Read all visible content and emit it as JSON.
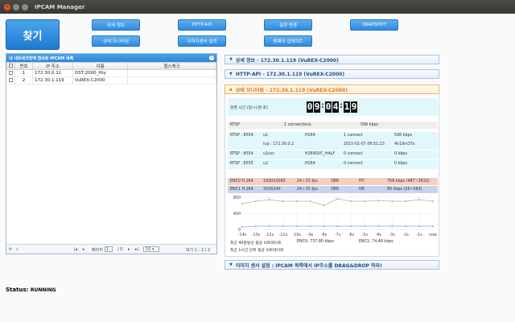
{
  "window": {
    "title": "IPCAM Manager"
  },
  "search_button": "찾기",
  "nav": {
    "detail_info": "상세 정보",
    "http_api": "HTTP-API",
    "config_change": "설정 변경",
    "snapshot": "SNAPSHOT",
    "status_monitor": "상태 모니터링",
    "image_sensor": "이미지센서 설정",
    "firmware": "펌웨어 업데이트"
  },
  "camera_list": {
    "header": "내 네트워크망에 접속된 IPCAM 목록",
    "columns": [
      "번호",
      "IP 주소",
      "이름",
      "헬스체크"
    ],
    "rows": [
      {
        "no": "1",
        "ip": "172.30.0.11",
        "name": "DST-2000_Hty",
        "health": ""
      },
      {
        "no": "2",
        "ip": "172.30.1.119",
        "name": "VuREX-C2000",
        "health": ""
      }
    ],
    "pager": {
      "page_label": "페이지",
      "page_value": "1",
      "of_total": "/ 0",
      "page_size": "10",
      "range": "보기 1 - 2 / 2"
    }
  },
  "sections": {
    "detail": "상세 정보 - 172.30.1.119 (VuREX-C2000)",
    "http_api": "HTTP-API - 172.30.1.119 (VuREX-C2000)",
    "monitor": "상태 모니터링 - 172.30.1.119 (VuREX-C2000)",
    "image_sensor": "이미지 센서 설정 : IPCAM 목록에서 IP주소를 DRAG&DROP 하라!"
  },
  "monitor": {
    "uptime_label": "운영 시간 (일:시:분:초)",
    "uptime": [
      "0",
      "9",
      "0",
      "4",
      "1",
      "9"
    ],
    "rtsp_summary": {
      "label": "RTSP",
      "connections": "1 connections",
      "rate": "596 kbps"
    },
    "rtsp_rows": [
      {
        "port": "RTSP : 8554",
        "stream": "u1",
        "codec": "H264",
        "conn": "1 connect",
        "rate": "596 kbps"
      },
      {
        "port": "",
        "stream": "tcp : 172.30.0.2",
        "codec": "",
        "conn": "2015-01-07 06:51:23",
        "rate": "4h19m37s"
      },
      {
        "port": "RTSP : 8554",
        "stream": "u1svc",
        "codec": "H264SVC_HALF",
        "conn": "0 connect",
        "rate": "0 kbps"
      },
      {
        "port": "RTSP : 8555",
        "stream": "u2",
        "codec": "H264",
        "conn": "0 connect",
        "rate": "0 kbps"
      }
    ],
    "encoders": [
      {
        "name": "ENC0 H.264",
        "res": "1920X1080",
        "fps": "24 / 25 fps",
        "mode": "VBR",
        "quality": "HT",
        "rate": "758 kbps (487~2832)"
      },
      {
        "name": "ENC1 H.264",
        "res": "320X240",
        "fps": "24 / 25 fps",
        "mode": "VBR",
        "quality": "HR",
        "rate": "80 kbps (26~563)"
      }
    ],
    "footer": {
      "avg_40s": "최근 40분동안 평균 비트레이트",
      "avg_1h": "최근 1시간 단위 평균 비트레이트",
      "enc0": "ENC0: 737.80 kbps",
      "enc1": "ENC1: 74.48 kbps"
    }
  },
  "chart_data": {
    "type": "line",
    "x": [
      "-14s",
      "-13s",
      "-12s",
      "-11s",
      "-10s",
      "-9s",
      "-8s",
      "-7s",
      "-6s",
      "-5s",
      "-4s",
      "-3s",
      "-2s",
      "-1s",
      "now"
    ],
    "yticks": [
      "800",
      "400",
      "0"
    ],
    "ylim": [
      0,
      800
    ],
    "grid": true,
    "series": [
      {
        "values": [
          640,
          700,
          740,
          700,
          700,
          700,
          600,
          760,
          700,
          700,
          720,
          700,
          700,
          740,
          700
        ],
        "color": "#b0b0b0"
      },
      {
        "values": [
          60,
          80,
          80,
          80,
          80,
          80,
          80,
          80,
          80,
          80,
          80,
          80,
          80,
          80,
          80
        ],
        "color": "#7faad8"
      }
    ]
  },
  "status": {
    "label": "Status:",
    "value": "RUNNING"
  }
}
